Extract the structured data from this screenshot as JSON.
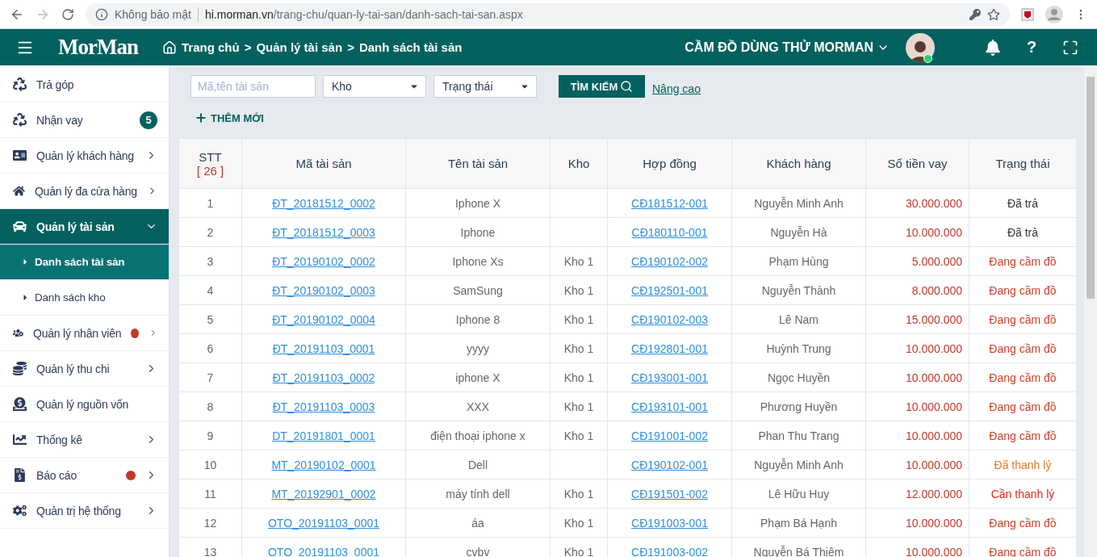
{
  "browser": {
    "security": "Không bảo mật",
    "url_host": "hi.morman.vn",
    "url_path": "/trang-chu/quan-ly-tai-san/danh-sach-tai-san.aspx"
  },
  "header": {
    "logo": "MorMan",
    "breadcrumb": [
      "Trang chủ",
      "Quản lý tài sản",
      "Danh sách tài sản"
    ],
    "separator": ">",
    "shop": "CẦM ĐỒ DÙNG THỬ MORMAN",
    "help": "?"
  },
  "sidebar": {
    "items": [
      {
        "label": "Trả góp",
        "selected": false
      },
      {
        "label": "Nhận vay",
        "badge": "5",
        "selected": false
      },
      {
        "label": "Quản lý khách hàng",
        "chevron": true,
        "selected": false
      },
      {
        "label": "Quản lý đa cửa hàng",
        "chevron": true,
        "selected": false
      },
      {
        "label": "Quản lý tài sản",
        "chevron": true,
        "expanded": true,
        "selected": true,
        "children": [
          {
            "label": "Danh sách tài sản",
            "selected": true
          },
          {
            "label": "Danh sách kho",
            "selected": false
          }
        ]
      },
      {
        "label": "Quản lý nhân viên",
        "alert": true,
        "chevron": true,
        "selected": false
      },
      {
        "label": "Quản lý thu chi",
        "chevron": true,
        "selected": false
      },
      {
        "label": "Quản lý nguồn vốn",
        "selected": false
      },
      {
        "label": "Thống kê",
        "chevron": true,
        "selected": false
      },
      {
        "label": "Báo cáo",
        "alert": true,
        "chevron": true,
        "selected": false
      },
      {
        "label": "Quản trị hệ thống",
        "chevron": true,
        "selected": false
      }
    ]
  },
  "filters": {
    "search": {
      "placeholder": "Mã,tên tài sản"
    },
    "selects": [
      "Kho",
      "Trạng thái"
    ],
    "search_button": "TÌM KIẾM",
    "advanced": "Nâng cao",
    "add": "THÊM MỚI"
  },
  "table": {
    "columns": [
      "STT",
      "Mã tài sản",
      "Tên tài sản",
      "Kho",
      "Hợp đồng",
      "Khách hàng",
      "Số tiền vay",
      "Trạng thái"
    ],
    "count": "[ 26 ]",
    "rows": [
      {
        "stt": "1",
        "code": "ĐT_20181512_0002",
        "name": "Iphone X",
        "warehouse": "",
        "contract": "CĐ181512-001",
        "customer": "Nguyễn Minh Anh",
        "amount": "30.000.000",
        "status": "Đã trả",
        "color": "#333333"
      },
      {
        "stt": "2",
        "code": "ĐT_20181512_0003",
        "name": "Iphone",
        "warehouse": "",
        "contract": "CĐ180110-001",
        "customer": "Nguyễn Hà",
        "amount": "10.000.000",
        "status": "Đã trả",
        "color": "#333333"
      },
      {
        "stt": "3",
        "code": "ĐT_20190102_0002",
        "name": "Iphone Xs",
        "warehouse": "Kho 1",
        "contract": "CĐ190102-002",
        "customer": "Phạm Hùng",
        "amount": "5.000.000",
        "status": "Đang cầm đồ",
        "color": "#d0402b"
      },
      {
        "stt": "4",
        "code": "ĐT_20190102_0003",
        "name": "SamSung",
        "warehouse": "Kho 1",
        "contract": "CĐ192501-001",
        "customer": "Nguyễn Thành",
        "amount": "8.000.000",
        "status": "Đang cầm đồ",
        "color": "#d0402b"
      },
      {
        "stt": "5",
        "code": "ĐT_20190102_0004",
        "name": "Iphone 8",
        "warehouse": "Kho 1",
        "contract": "CĐ190102-003",
        "customer": "Lê Nam",
        "amount": "15.000.000",
        "status": "Đang cầm đồ",
        "color": "#d0402b"
      },
      {
        "stt": "6",
        "code": "ĐT_20191103_0001",
        "name": "yyyy",
        "warehouse": "Kho 1",
        "contract": "CĐ192801-001",
        "customer": "Huỳnh Trung",
        "amount": "10.000.000",
        "status": "Đang cầm đồ",
        "color": "#d0402b"
      },
      {
        "stt": "7",
        "code": "ĐT_20191103_0002",
        "name": "iphone X",
        "warehouse": "Kho 1",
        "contract": "CĐ193001-001",
        "customer": "Ngọc Huyền",
        "amount": "10.000.000",
        "status": "Đang cầm đồ",
        "color": "#d0402b"
      },
      {
        "stt": "8",
        "code": "ĐT_20191103_0003",
        "name": "XXX",
        "warehouse": "Kho 1",
        "contract": "CĐ193101-001",
        "customer": "Phương Huyền",
        "amount": "10.000.000",
        "status": "Đang cầm đồ",
        "color": "#d0402b"
      },
      {
        "stt": "9",
        "code": "DT_20191801_0001",
        "name": "điện thoại iphone x",
        "warehouse": "Kho 1",
        "contract": "CĐ191001-002",
        "customer": "Phan Thu Trang",
        "amount": "10.000.000",
        "status": "Đang cầm đồ",
        "color": "#d0402b"
      },
      {
        "stt": "10",
        "code": "MT_20190102_0001",
        "name": "Dell",
        "warehouse": "",
        "contract": "CĐ190102-001",
        "customer": "Nguyễn Minh Anh",
        "amount": "10.000.000",
        "status": "Đã thanh lý",
        "color": "#e67e22"
      },
      {
        "stt": "11",
        "code": "MT_20192901_0002",
        "name": "máy tính dell",
        "warehouse": "Kho 1",
        "contract": "CĐ191501-002",
        "customer": "Lê Hữu Huy",
        "amount": "12.000.000",
        "status": "Cần thanh lý",
        "color": "#e8261c"
      },
      {
        "stt": "12",
        "code": "OTO_20191103_0001",
        "name": "áa",
        "warehouse": "Kho 1",
        "contract": "CĐ191003-001",
        "customer": "Phạm Bá Hạnh",
        "amount": "10.000.000",
        "status": "Đang cầm đồ",
        "color": "#d0402b"
      },
      {
        "stt": "13",
        "code": "OTO_20191103_0001",
        "name": "cvbv",
        "warehouse": "Kho 1",
        "contract": "CĐ191003-002",
        "customer": "Nguyễn Bá Thiêm",
        "amount": "10.000.000",
        "status": "Đang cầm đồ",
        "color": "#d0402b"
      }
    ]
  }
}
